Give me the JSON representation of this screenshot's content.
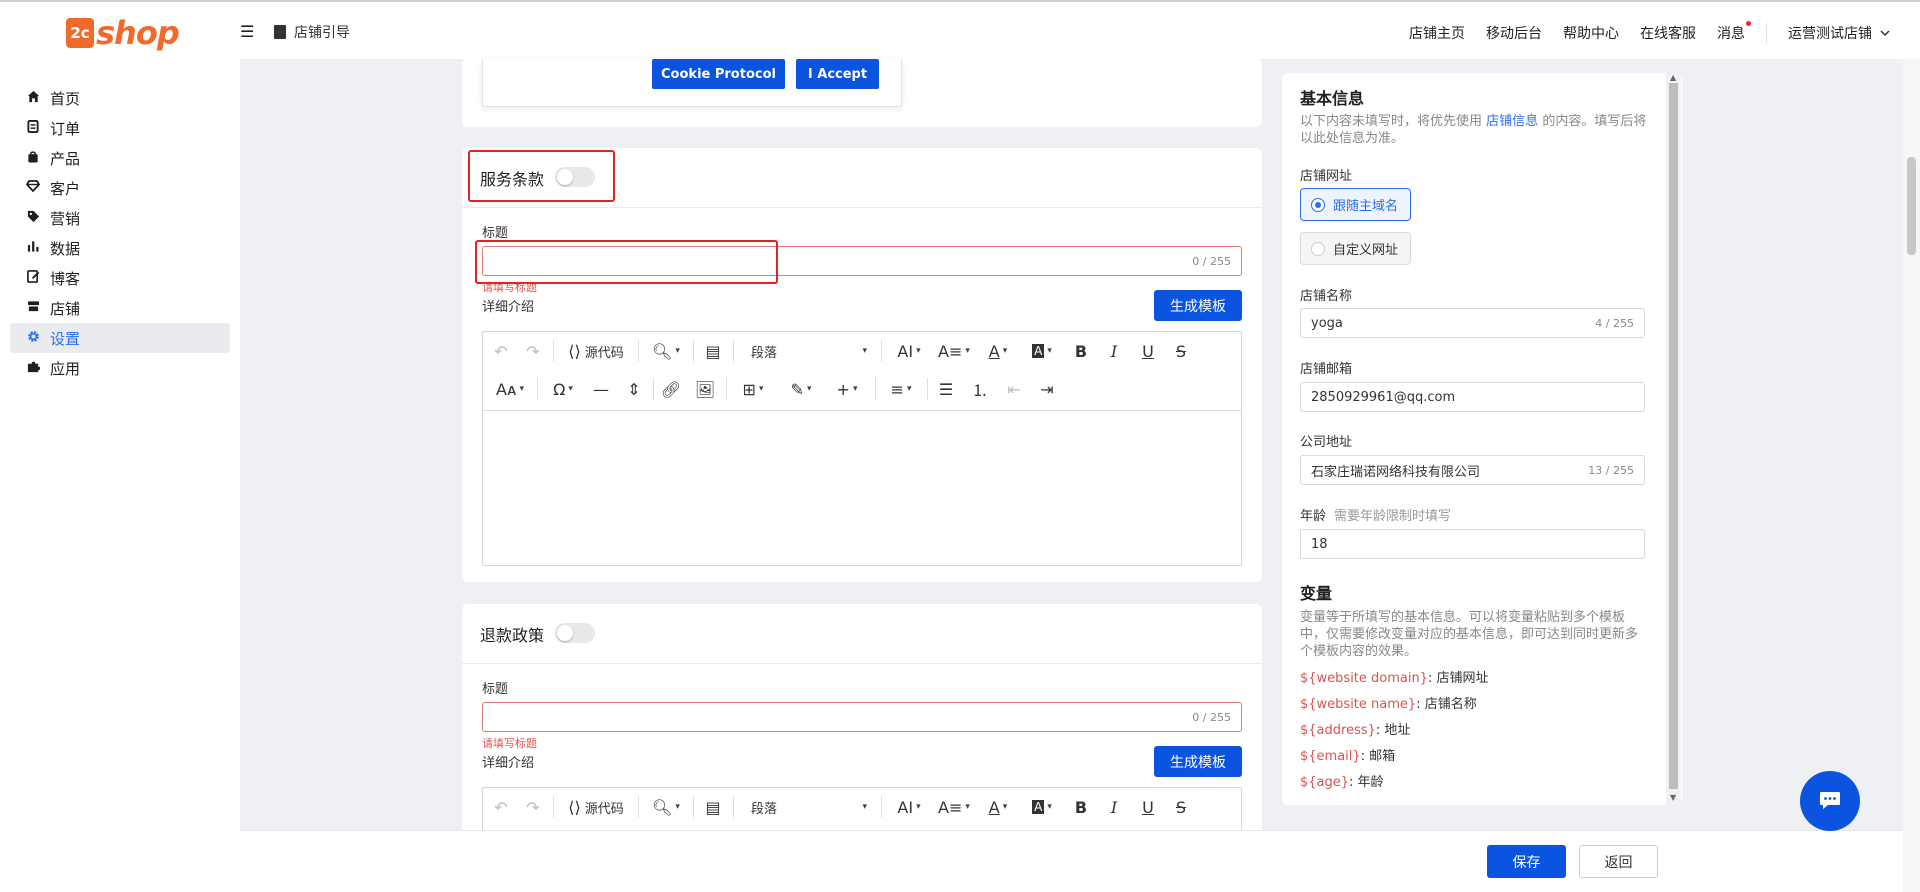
{
  "app": {
    "logo_badge": "2c",
    "logo_text": "shop"
  },
  "header": {
    "guide": "店铺引导",
    "nav": [
      "店铺主页",
      "移动后台",
      "帮助中心",
      "在线客服",
      "消息"
    ],
    "store": "运营测试店铺"
  },
  "sidebar": {
    "items": [
      {
        "label": "首页",
        "icon": "home-icon"
      },
      {
        "label": "订单",
        "icon": "order-icon"
      },
      {
        "label": "产品",
        "icon": "product-icon"
      },
      {
        "label": "客户",
        "icon": "customer-icon"
      },
      {
        "label": "营销",
        "icon": "tag-icon"
      },
      {
        "label": "数据",
        "icon": "chart-icon"
      },
      {
        "label": "博客",
        "icon": "blog-icon"
      },
      {
        "label": "店铺",
        "icon": "store-icon"
      },
      {
        "label": "设置",
        "icon": "gear-icon",
        "active": true
      },
      {
        "label": "应用",
        "icon": "puzzle-icon"
      }
    ]
  },
  "cookie": {
    "protocol_label": "Cookie Protocol",
    "accept_label": "I Accept"
  },
  "sections": [
    {
      "title": "服务条款",
      "enabled": false,
      "title_label": "标题",
      "title_value": "",
      "title_count": "0 / 255",
      "error": "请填写标题",
      "detail_label": "详细介绍",
      "generate_label": "生成模板"
    },
    {
      "title": "退款政策",
      "enabled": false,
      "title_label": "标题",
      "title_value": "",
      "title_count": "0 / 255",
      "error": "请填写标题",
      "detail_label": "详细介绍",
      "generate_label": "生成模板"
    }
  ],
  "editor": {
    "source_label": "源代码",
    "paragraph_label": "段落"
  },
  "right_panel": {
    "basic_title": "基本信息",
    "basic_note_pre": "以下内容未填写时，将优先使用",
    "basic_note_link": "店铺信息",
    "basic_note_post": "的内容。填写后将以此处信息为准。",
    "url_label": "店铺网址",
    "url_options": [
      "跟随主域名",
      "自定义网址"
    ],
    "url_selected": 0,
    "name_label": "店铺名称",
    "name_value": "yoga",
    "name_count": "4 / 255",
    "email_label": "店铺邮箱",
    "email_value": "2850929961@qq.com",
    "address_label": "公司地址",
    "address_value": "石家庄瑞诺网络科技有限公司",
    "address_count": "13 / 255",
    "age_label": "年龄",
    "age_hint": "需要年龄限制时填写",
    "age_value": "18",
    "vars_title": "变量",
    "vars_note": "变量等于所填写的基本信息。可以将变量粘贴到多个模板中，仅需要修改变量对应的基本信息，即可达到同时更新多个模板内容的效果。",
    "variables": [
      {
        "key": "${website domain}",
        "desc": ": 店铺网址"
      },
      {
        "key": "${website name}",
        "desc": ": 店铺名称"
      },
      {
        "key": "${address}",
        "desc": ": 地址"
      },
      {
        "key": "${email}",
        "desc": ": 邮箱"
      },
      {
        "key": "${age}",
        "desc": ": 年龄"
      }
    ]
  },
  "footer": {
    "save_label": "保存",
    "back_label": "返回"
  },
  "colors": {
    "primary": "#0a54e0",
    "brand": "#f26a2b",
    "error": "#e55353",
    "highlight": "#e02424"
  }
}
